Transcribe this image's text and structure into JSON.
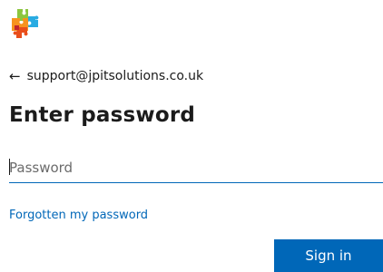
{
  "brand": {
    "logo_icon": "puzzle-pieces-logo-icon",
    "colors": [
      "#8cc63f",
      "#e94e1b",
      "#29abe2",
      "#f7931e",
      "#c1272d"
    ]
  },
  "identity": {
    "back_icon": "arrow-left-icon",
    "back_glyph": "←",
    "email": "support@jpitsolutions.co.uk"
  },
  "heading": "Enter password",
  "password": {
    "placeholder": "Password",
    "value": ""
  },
  "forgot_link": "Forgotten my password",
  "signin_label": "Sign in",
  "accent_color": "#0067b8"
}
